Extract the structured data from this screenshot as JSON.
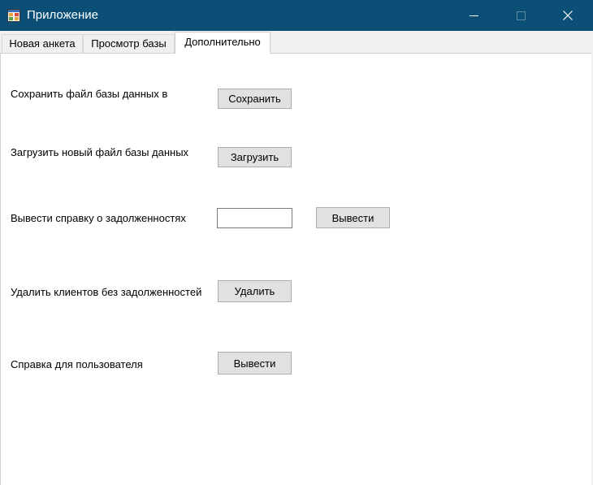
{
  "window": {
    "title": "Приложение",
    "title_bar_color": "#0b4f77",
    "icon": "app-window-icon"
  },
  "title_buttons": {
    "minimize_icon": "minimize-icon",
    "maximize_icon": "maximize-icon",
    "close_icon": "close-icon"
  },
  "tabs": [
    {
      "label": "Новая анкета",
      "selected": false
    },
    {
      "label": "Просмотр базы",
      "selected": false
    },
    {
      "label": "Дополнительно",
      "selected": true
    }
  ],
  "content": {
    "save_db": {
      "label": "Сохранить файл базы данных в",
      "button": "Сохранить"
    },
    "load_db": {
      "label": "Загрузить новый файл базы данных",
      "button": "Загрузить"
    },
    "debt_report": {
      "label": "Вывести справку о задолженностях",
      "input_value": "",
      "button": "Вывести"
    },
    "delete_clients": {
      "label": "Удалить клиентов без задолженностей",
      "button": "Удалить"
    },
    "user_help": {
      "label": "Справка для пользователя",
      "button": "Вывести"
    }
  }
}
